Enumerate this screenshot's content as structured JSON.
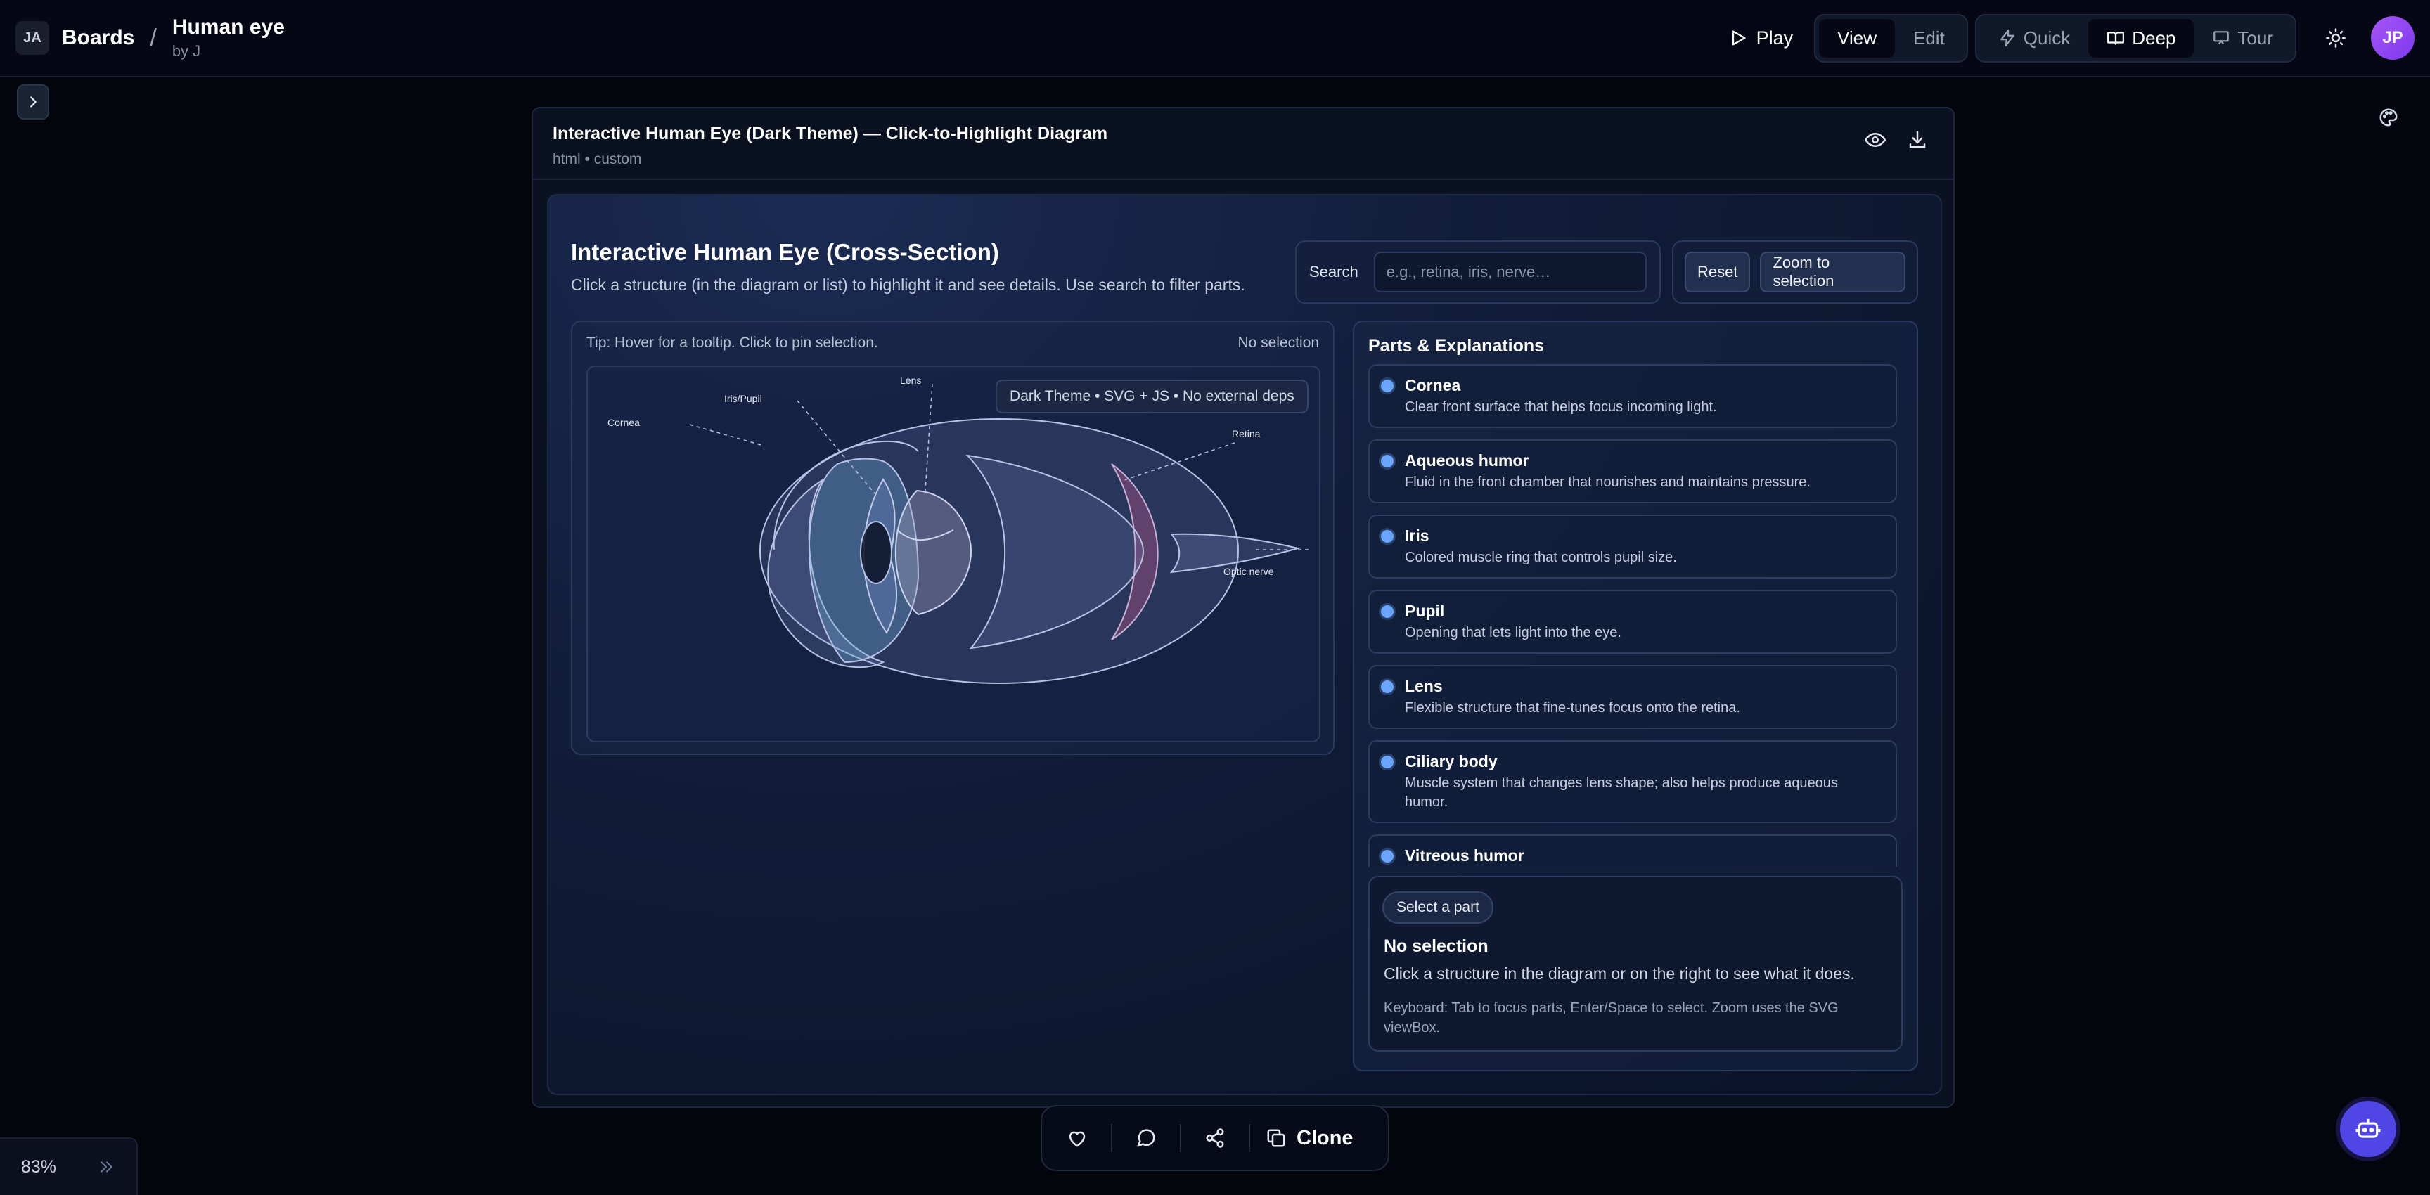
{
  "header": {
    "logo_text": "JA",
    "breadcrumb_root": "Boards",
    "breadcrumb_sep": "/",
    "board_title": "Human eye",
    "board_author": "by J",
    "play_label": "Play",
    "mode_view": "View",
    "mode_edit": "Edit",
    "depth_quick": "Quick",
    "depth_deep": "Deep",
    "depth_tour": "Tour",
    "avatar_initials": "JP"
  },
  "artifact": {
    "title": "Interactive Human Eye (Dark Theme) — Click-to-Highlight Diagram",
    "meta": "html • custom"
  },
  "app": {
    "title": "Interactive Human Eye (Cross-Section)",
    "subtitle": "Click a structure (in the diagram or list) to highlight it and see details. Use search to filter parts.",
    "search_label": "Search",
    "search_placeholder": "e.g., retina, iris, nerve…",
    "reset_label": "Reset",
    "zoom_label": "Zoom to selection"
  },
  "diagram": {
    "tip": "Tip: Hover for a tooltip. Click to pin selection.",
    "selection_state": "No selection",
    "badge": "Dark Theme • SVG + JS • No external deps",
    "labels": {
      "cornea": "Cornea",
      "iris_pupil": "Iris/Pupil",
      "lens": "Lens",
      "retina": "Retina",
      "optic_nerve": "Optic nerve"
    }
  },
  "parts": {
    "title": "Parts & Explanations",
    "items": [
      {
        "name": "Cornea",
        "desc": "Clear front surface that helps focus incoming light."
      },
      {
        "name": "Aqueous humor",
        "desc": "Fluid in the front chamber that nourishes and maintains pressure."
      },
      {
        "name": "Iris",
        "desc": "Colored muscle ring that controls pupil size."
      },
      {
        "name": "Pupil",
        "desc": "Opening that lets light into the eye."
      },
      {
        "name": "Lens",
        "desc": "Flexible structure that fine-tunes focus onto the retina."
      },
      {
        "name": "Ciliary body",
        "desc": "Muscle system that changes lens shape; also helps produce aqueous humor."
      },
      {
        "name": "Vitreous humor",
        "desc": ""
      }
    ]
  },
  "detail": {
    "pill": "Select a part",
    "title": "No selection",
    "text": "Click a structure in the diagram or on the right to see what it does.",
    "hint": "Keyboard: Tab to focus parts, Enter/Space to select. Zoom uses the SVG viewBox."
  },
  "bottom": {
    "clone_label": "Clone",
    "zoom_level": "83%"
  },
  "colors": {
    "accent": "#6aa6ff",
    "bot_button": "#4f46e5",
    "avatar": "#a855f7"
  }
}
